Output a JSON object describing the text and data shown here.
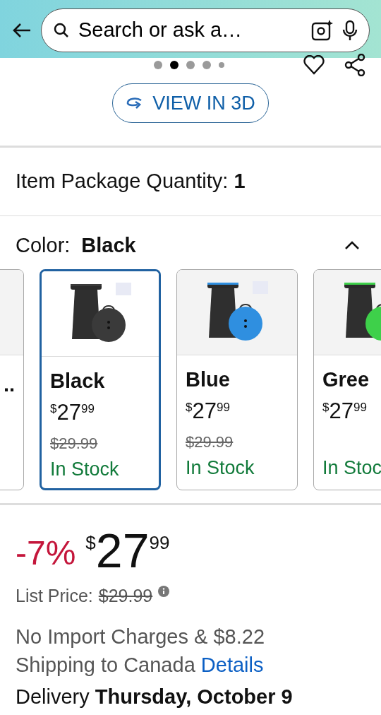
{
  "search": {
    "placeholder": "Search or ask a…"
  },
  "carousel": {
    "dots": [
      {
        "selected": false
      },
      {
        "selected": true
      },
      {
        "selected": false
      },
      {
        "selected": false
      },
      {
        "selected": false
      }
    ]
  },
  "view_3d_button": "VIEW IN 3D",
  "package_quantity": {
    "label": "Item Package Quantity:",
    "value": "1"
  },
  "color": {
    "label": "Color:",
    "value": "Black",
    "expanded": true
  },
  "swatches": [
    {
      "kind": "partial",
      "label": "..",
      "selected": false
    },
    {
      "kind": "full",
      "label": "Black",
      "currency": "$",
      "whole": "27",
      "fraction": "99",
      "was": "$29.99",
      "stock": "In Stock",
      "color": "#3a3a3a",
      "selected": true
    },
    {
      "kind": "full",
      "label": "Blue",
      "currency": "$",
      "whole": "27",
      "fraction": "99",
      "was": "$29.99",
      "stock": "In Stock",
      "color": "#2f8fe0",
      "selected": false
    },
    {
      "kind": "full",
      "label": "Gree",
      "currency": "$",
      "whole": "27",
      "fraction": "99",
      "stock": "In Stoc",
      "color": "#3ed04a",
      "selected": false
    }
  ],
  "price": {
    "discount": "-7%",
    "currency": "$",
    "whole": "27",
    "fraction": "99"
  },
  "list_price": {
    "label": "List Price:",
    "value": "$29.99"
  },
  "shipping": {
    "text": "No Import Charges & $8.22 Shipping to Canada",
    "link": "Details"
  },
  "delivery": "Delivery **Thursday, October 9**"
}
